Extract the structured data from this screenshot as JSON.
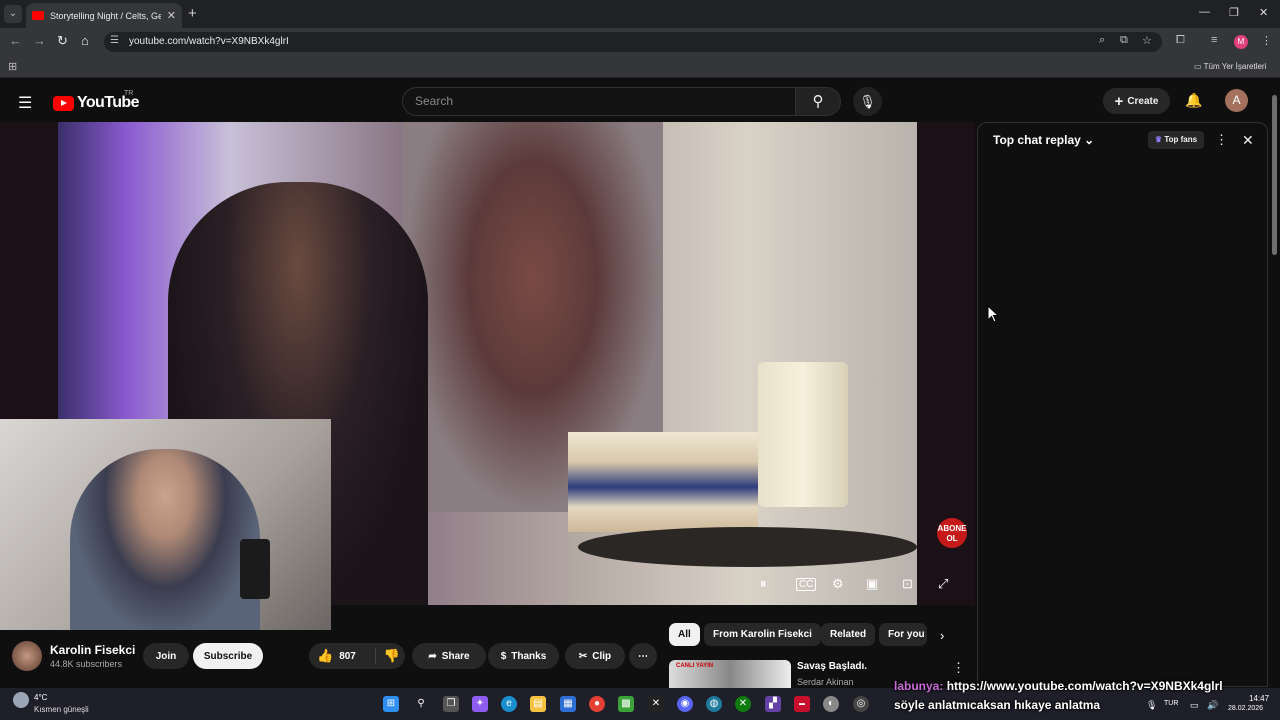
{
  "browser": {
    "tab_title": "Storytelling Night / Celts, Germ",
    "url": "youtube.com/watch?v=X9NBXk4glrI",
    "bookmarks_label": "Tüm Yer İşaretleri",
    "profile_initial": "M"
  },
  "youtube": {
    "logo_text": "YouTube",
    "country_code": "TR",
    "search_placeholder": "Search",
    "create_label": "Create",
    "avatar_initial": "A"
  },
  "chat": {
    "title": "Top chat replay",
    "top_fans_label": "Top fans"
  },
  "player": {
    "badge_line1": "ABONE",
    "badge_line2": "OL"
  },
  "channel": {
    "name": "Karolin Fisekci",
    "subscribers": "44.8K subscribers",
    "join_label": "Join",
    "subscribe_label": "Subscribe"
  },
  "actions": {
    "likes": "807",
    "share_label": "Share",
    "thanks_label": "Thanks",
    "clip_label": "Clip"
  },
  "chips": [
    "All",
    "From Karolin Fisekci",
    "Related",
    "For you"
  ],
  "recommendation": {
    "live_badge": "CANLI YAYIN",
    "title": "Savaş Başladı.",
    "author": "Serdar Akinan"
  },
  "taskbar": {
    "temperature": "4°C",
    "weather": "Kısmen güneşli",
    "language": "TUR",
    "time": "14:47",
    "date": "28.02.2026"
  },
  "overlay": {
    "user": "labunya:",
    "link": "https://www.youtube.com/watch?v=X9NBXk4glrl",
    "message": "söyle anlatmıcaksan hıkaye anlatma"
  }
}
